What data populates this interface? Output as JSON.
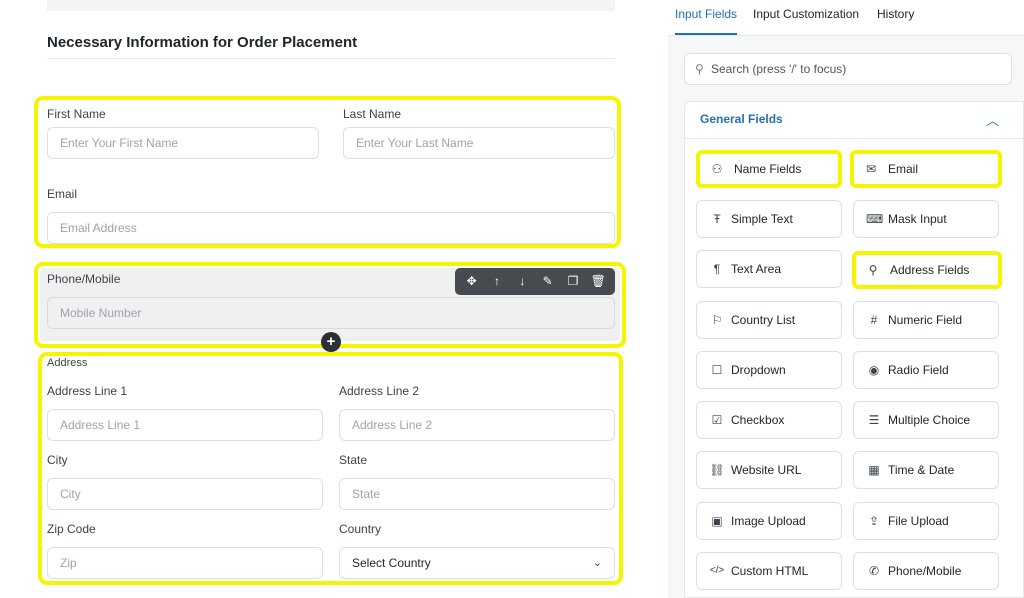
{
  "form": {
    "section_title": "Necessary Information for Order Placement",
    "first_name": {
      "label": "First Name",
      "placeholder": "Enter Your First Name"
    },
    "last_name": {
      "label": "Last Name",
      "placeholder": "Enter Your Last Name"
    },
    "email": {
      "label": "Email",
      "placeholder": "Email Address"
    },
    "phone": {
      "label": "Phone/Mobile",
      "placeholder": "Mobile Number"
    },
    "address": {
      "label": "Address",
      "line1": {
        "label": "Address Line 1",
        "placeholder": "Address Line 1"
      },
      "line2": {
        "label": "Address Line 2",
        "placeholder": "Address Line 2"
      },
      "city": {
        "label": "City",
        "placeholder": "City"
      },
      "state": {
        "label": "State",
        "placeholder": "State"
      },
      "zip": {
        "label": "Zip Code",
        "placeholder": "Zip"
      },
      "country": {
        "label": "Country",
        "value": "Select Country"
      }
    },
    "toolbar_icons": [
      "move-icon",
      "arrow-up-icon",
      "arrow-down-icon",
      "edit-icon",
      "duplicate-icon",
      "trash-icon"
    ],
    "highlight_color": "#f5f500"
  },
  "panel": {
    "tabs": [
      "Input Fields",
      "Input Customization",
      "History"
    ],
    "active_tab": "Input Fields",
    "search_placeholder": "Search (press '/' to focus)",
    "group_title": "General Fields",
    "fields": [
      {
        "label": "Name Fields",
        "icon": "user-icon"
      },
      {
        "label": "Email",
        "icon": "envelope-icon"
      },
      {
        "label": "Simple Text",
        "icon": "text-cursor-icon"
      },
      {
        "label": "Mask Input",
        "icon": "keyboard-icon"
      },
      {
        "label": "Text Area",
        "icon": "paragraph-icon"
      },
      {
        "label": "Address Fields",
        "icon": "map-pin-icon"
      },
      {
        "label": "Country List",
        "icon": "flag-icon"
      },
      {
        "label": "Numeric Field",
        "icon": "hash-icon"
      },
      {
        "label": "Dropdown",
        "icon": "dropdown-icon"
      },
      {
        "label": "Radio Field",
        "icon": "radio-icon"
      },
      {
        "label": "Checkbox",
        "icon": "checkbox-icon"
      },
      {
        "label": "Multiple Choice",
        "icon": "list-icon"
      },
      {
        "label": "Website URL",
        "icon": "link-icon"
      },
      {
        "label": "Time & Date",
        "icon": "calendar-icon"
      },
      {
        "label": "Image Upload",
        "icon": "image-icon"
      },
      {
        "label": "File Upload",
        "icon": "upload-icon"
      },
      {
        "label": "Custom HTML",
        "icon": "code-icon"
      },
      {
        "label": "Phone/Mobile",
        "icon": "phone-icon"
      }
    ],
    "accent_color": "#2271b1"
  }
}
